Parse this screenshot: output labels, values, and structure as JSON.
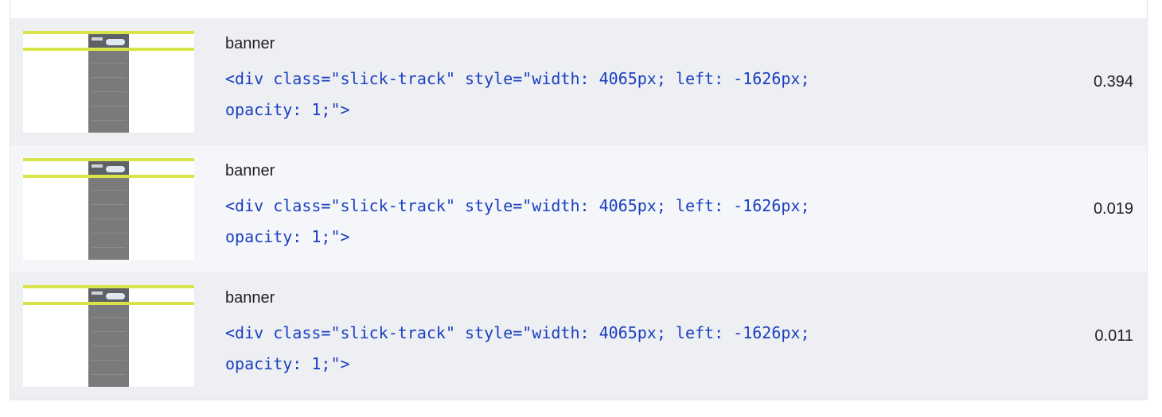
{
  "rows": [
    {
      "label": "banner",
      "code_line1": "<div class=\"slick-track\" style=\"width: 4065px; left: -1626px;",
      "code_line2": "opacity: 1;\">",
      "value": "0.394"
    },
    {
      "label": "banner",
      "code_line1": "<div class=\"slick-track\" style=\"width: 4065px; left: -1626px;",
      "code_line2": "opacity: 1;\">",
      "value": "0.019"
    },
    {
      "label": "banner",
      "code_line1": "<div class=\"slick-track\" style=\"width: 4065px; left: -1626px;",
      "code_line2": "opacity: 1;\">",
      "value": "0.011"
    }
  ],
  "colors": {
    "highlight": "#d8e44a",
    "code_text": "#1a3fc0",
    "row_odd": "#edeff2",
    "row_even": "#f4f6f9"
  }
}
